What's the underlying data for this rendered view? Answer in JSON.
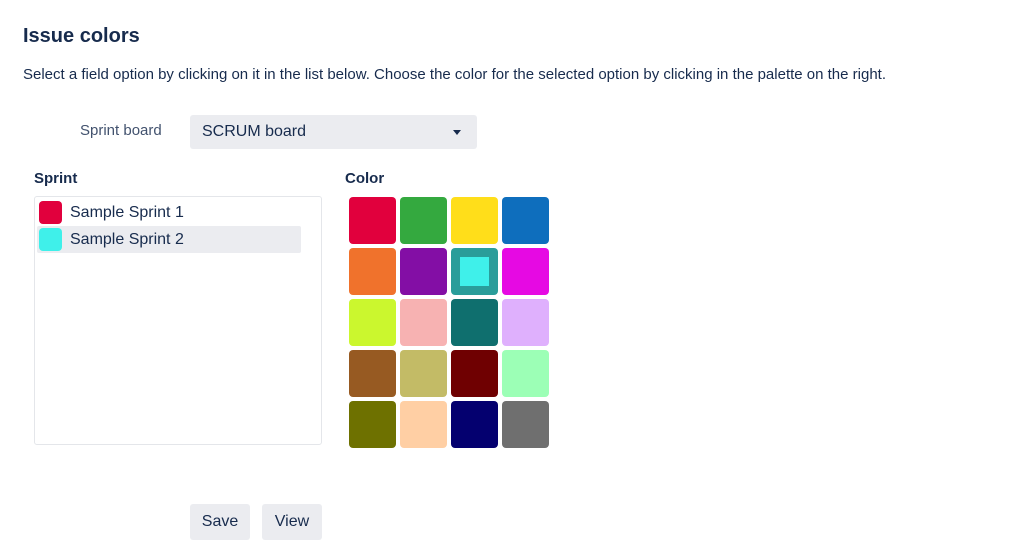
{
  "header": {
    "title": "Issue colors",
    "description": "Select a field option by clicking on it in the list below. Choose the color for the selected option by clicking in the palette on the right."
  },
  "board": {
    "label": "Sprint board",
    "selected": "SCRUM board"
  },
  "sprint_section": {
    "heading": "Sprint",
    "items": [
      {
        "label": "Sample Sprint 1",
        "color": "#e1003d",
        "selected": false
      },
      {
        "label": "Sample Sprint 2",
        "color": "#3ff0ea",
        "selected": true
      }
    ]
  },
  "color_section": {
    "heading": "Color",
    "palette": [
      "#e1003d",
      "#34a93f",
      "#ffde1a",
      "#0e6ebd",
      "#f0722c",
      "#830ea5",
      "#3ff0ea",
      "#e609e3",
      "#cbf72e",
      "#f7b2b2",
      "#0f6f6e",
      "#dfb0fd",
      "#975a22",
      "#c3bb66",
      "#6f0001",
      "#9cffb6",
      "#6e7100",
      "#ffcfa4",
      "#04006f",
      "#6f6f6f"
    ],
    "selected_index": 6
  },
  "actions": {
    "save_label": "Save",
    "view_label": "View"
  }
}
